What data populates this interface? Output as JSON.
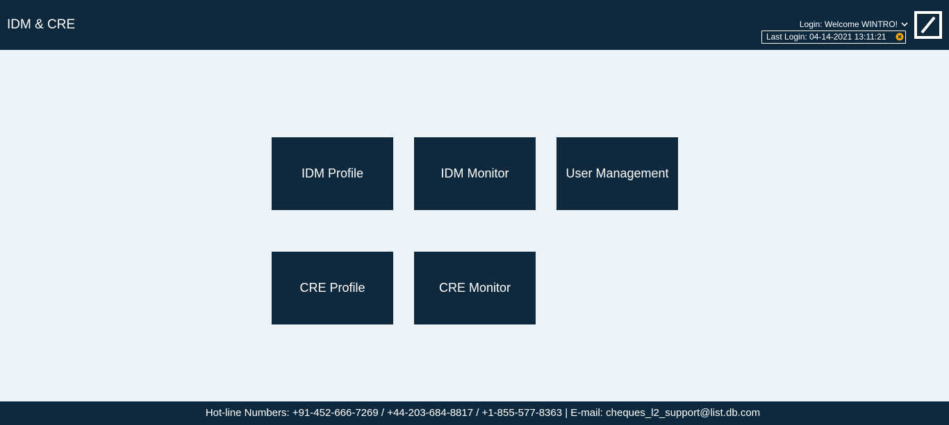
{
  "header": {
    "app_title": "IDM & CRE",
    "login_text": "Login: Welcome WINTRO!",
    "last_login_text": "Last Login: 04-14-2021 13:11:21",
    "logo_icon": "bank-logo-slash-square",
    "chevron_icon": "chevron-down",
    "dismiss_icon": "close-circle"
  },
  "tiles": [
    {
      "label": "IDM Profile"
    },
    {
      "label": "IDM Monitor"
    },
    {
      "label": "User Management"
    },
    {
      "label": "CRE Profile"
    },
    {
      "label": "CRE Monitor"
    }
  ],
  "footer": {
    "text": "Hot-line Numbers: +91-452-666-7269 / +44-203-684-8817 / +1-855-577-8363 | E-mail: cheques_l2_support@list.db.com"
  },
  "colors": {
    "primary_dark": "#0e293e",
    "background": "#eef3f7",
    "dismiss_accent": "#f0a500"
  }
}
